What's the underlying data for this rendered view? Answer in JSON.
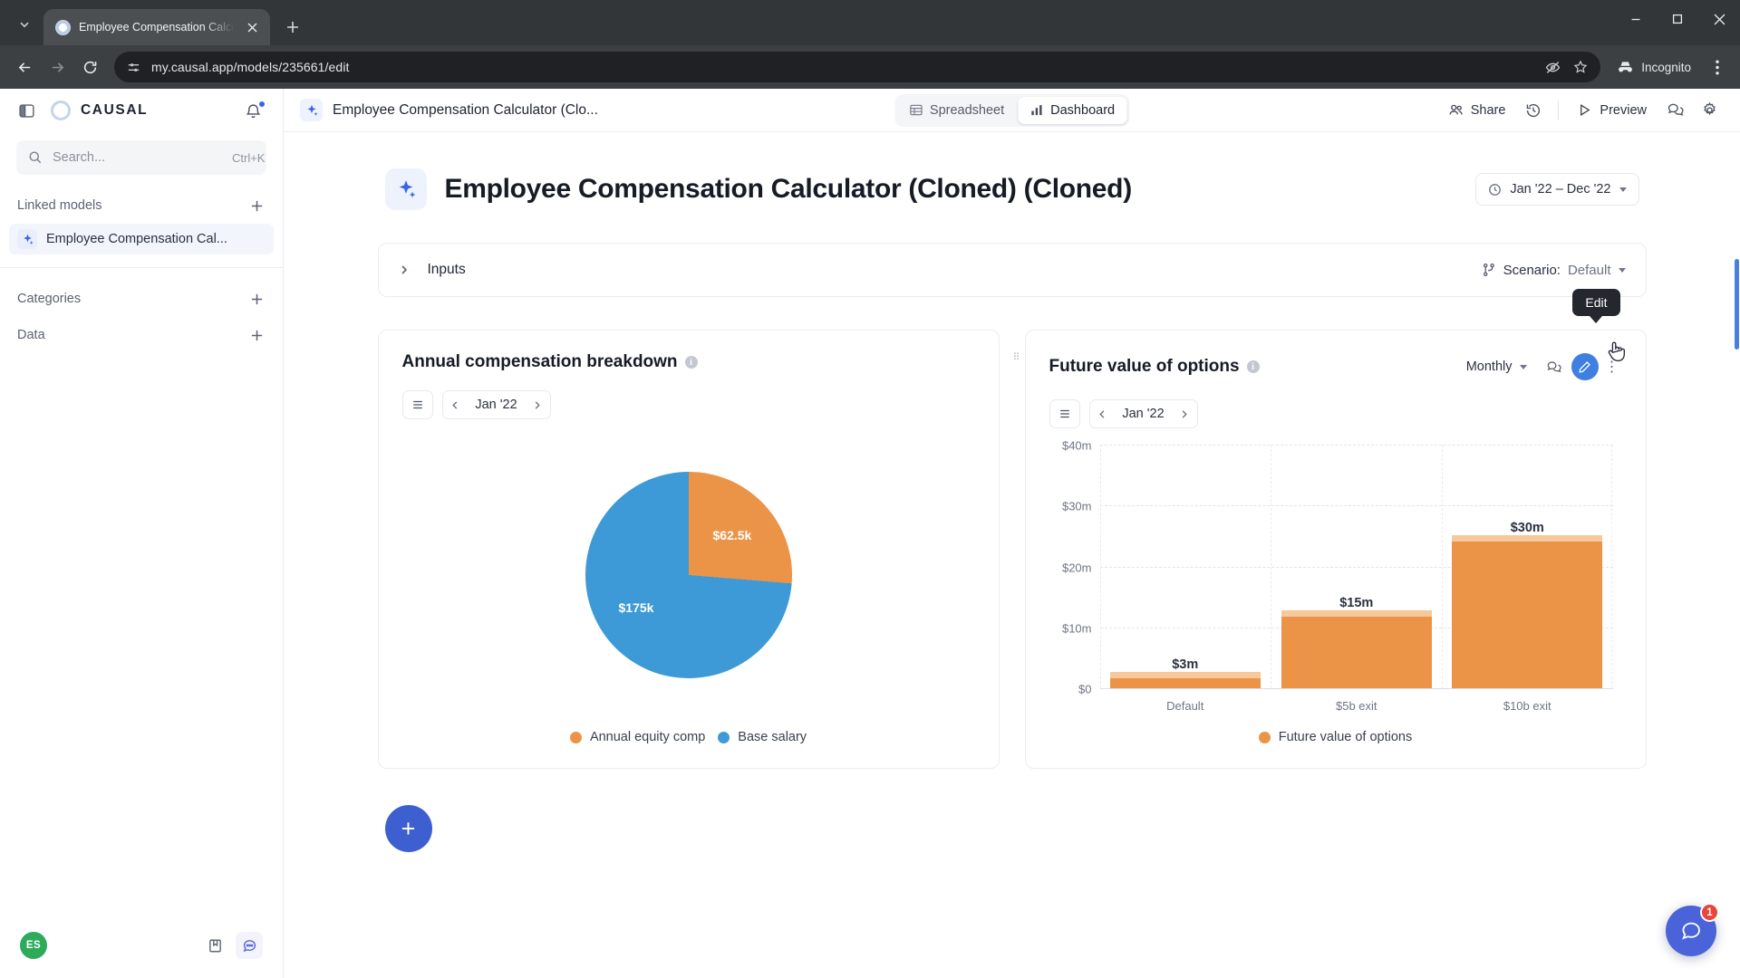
{
  "browser": {
    "tab_title": "Employee Compensation Calcu",
    "url": "my.causal.app/models/235661/edit",
    "profile_label": "Incognito",
    "new_tab_label": "+",
    "icons": {
      "tab_search": "chevron-down-icon",
      "back": "back-arrow-icon",
      "forward": "forward-arrow-icon",
      "reload": "reload-icon",
      "site_settings": "page-settings-icon",
      "extensions": "extensions-icon",
      "bookmark": "star-icon",
      "menu": "three-dot-menu-icon",
      "minimize": "minimize-icon",
      "maximize": "maximize-icon",
      "close": "window-close-icon"
    }
  },
  "sidebar": {
    "brand": "CAUSAL",
    "search": {
      "placeholder": "Search...",
      "value": "",
      "shortcut": "Ctrl+K"
    },
    "sections": [
      {
        "title": "Linked models"
      },
      {
        "title": "Categories"
      },
      {
        "title": "Data"
      }
    ],
    "linked_models": [
      {
        "label": "Employee Compensation Cal..."
      }
    ],
    "user_initials": "ES"
  },
  "topbar": {
    "model_name": "Employee Compensation Calculator (Clo...",
    "tabs": [
      {
        "label": "Spreadsheet",
        "active": false
      },
      {
        "label": "Dashboard",
        "active": true
      }
    ],
    "share_label": "Share",
    "preview_label": "Preview"
  },
  "page": {
    "title": "Employee Compensation Calculator (Cloned) (Cloned)",
    "date_range": "Jan '22 – Dec '22",
    "inputs_label": "Inputs",
    "scenario_label": "Scenario:",
    "scenario_value": "Default"
  },
  "cards": [
    {
      "title": "Annual compensation breakdown",
      "period": "Jan '22"
    },
    {
      "title": "Future value of options",
      "period": "Jan '22",
      "granularity": "Monthly"
    }
  ],
  "tooltip": {
    "text": "Edit"
  },
  "fab": {
    "label": "+"
  },
  "chat": {
    "badge": "1"
  },
  "colors": {
    "orange": "#eb9448",
    "orange_light": "#f6c89a",
    "blue": "#3d9ad6",
    "accent": "#3d5fd0",
    "green": "#2eaa5b"
  },
  "chart_data": [
    {
      "type": "pie",
      "title": "Annual compensation breakdown",
      "period": "Jan '22",
      "labels": [
        "Annual equity comp",
        "Base salary"
      ],
      "values": [
        62500,
        175000
      ],
      "value_labels": [
        "$62.5k",
        "$175k"
      ],
      "colors": [
        "#eb9448",
        "#3d9ad6"
      ],
      "legend": "bottom"
    },
    {
      "type": "bar",
      "title": "Future value of options",
      "period": "Jan '22",
      "granularity": "Monthly",
      "categories": [
        "Default",
        "$5b exit",
        "$10b exit"
      ],
      "values": [
        3,
        15,
        30
      ],
      "value_labels": [
        "$3m",
        "$15m",
        "$30m"
      ],
      "series": [
        {
          "name": "Future value of options",
          "values": [
            3,
            15,
            30
          ]
        }
      ],
      "ylabel": "",
      "xlabel": "",
      "ylim": [
        0,
        40
      ],
      "yticks": [
        0,
        10,
        20,
        30,
        40
      ],
      "ytick_labels": [
        "$0",
        "$10m",
        "$20m",
        "$30m",
        "$40m"
      ],
      "grid": true,
      "legend": "bottom",
      "legend_entries": [
        "Future value of options"
      ],
      "color": "#eb9448"
    }
  ]
}
